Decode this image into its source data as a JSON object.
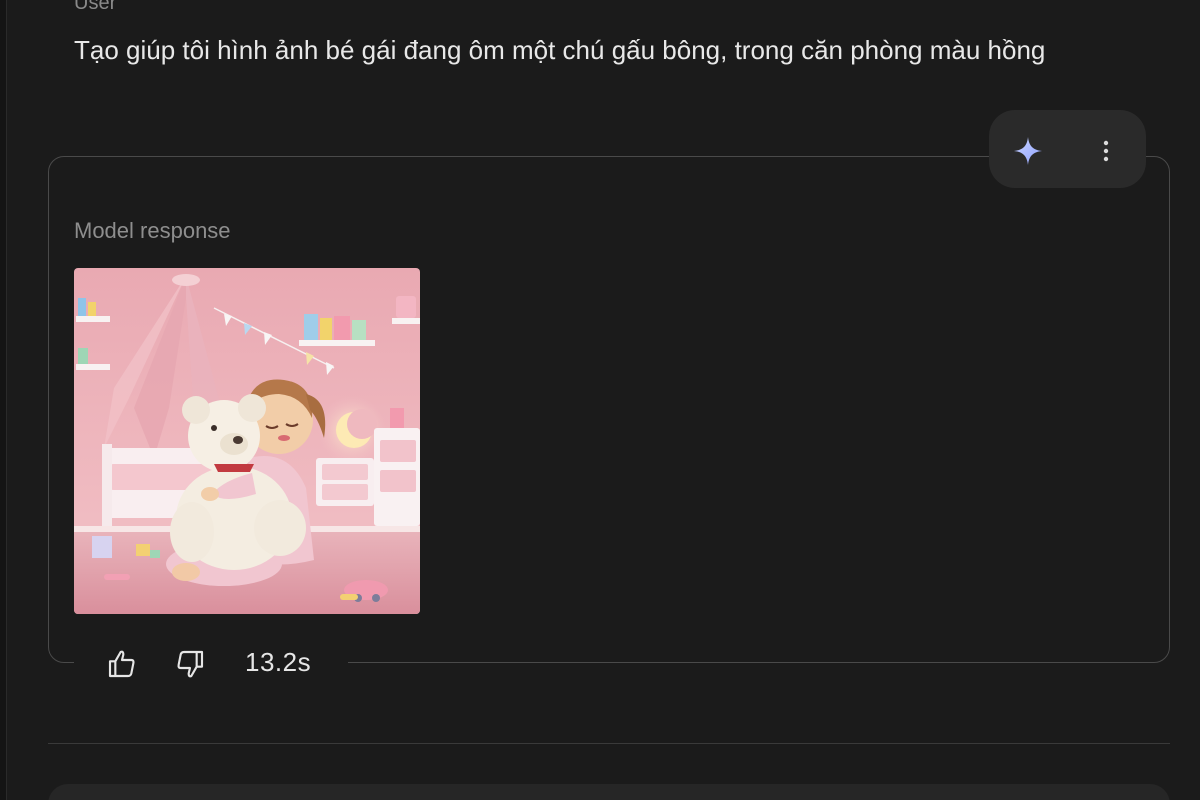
{
  "user_turn": {
    "role_label": "User",
    "message": "Tạo giúp tôi hình ảnh bé gái đang ôm một chú gấu bông, trong căn phòng màu hồng"
  },
  "model_turn": {
    "label": "Model response",
    "image_alt": "Bé gái ôm chú gấu bông trắng trong căn phòng màu hồng",
    "elapsed_time": "13.2s"
  },
  "icons": {
    "sparkle": "sparkle-icon",
    "more": "more-vert-icon",
    "thumb_up": "thumb-up-icon",
    "thumb_down": "thumb-down-icon"
  },
  "colors": {
    "background": "#1b1b1b",
    "card_border": "#4a4a4a",
    "sparkle": "#a8b8ff"
  }
}
